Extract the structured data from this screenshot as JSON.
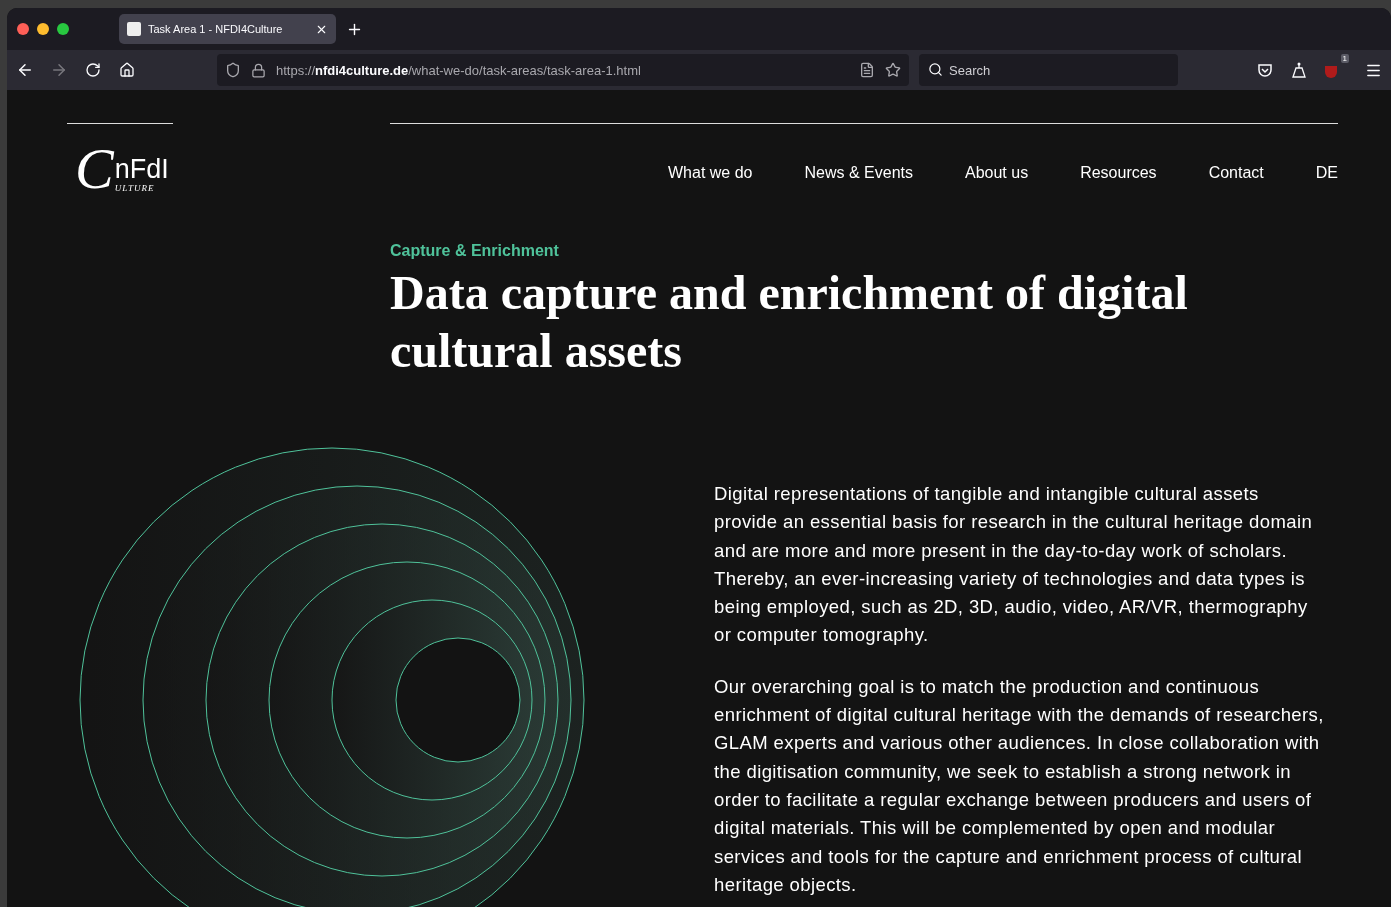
{
  "browser": {
    "tab": {
      "title": "Task Area 1 - NFDI4Culture",
      "selected": true
    },
    "url": {
      "scheme": "https://",
      "host": "nfdi4culture.de",
      "path": "/what-we-do/task-areas/task-area-1.html"
    },
    "search": {
      "placeholder": "Search"
    },
    "extension_badge": "1"
  },
  "logo": {
    "initial": "C",
    "letters": "nFdI",
    "subline": "ULTURE"
  },
  "nav": [
    {
      "label": "What we do"
    },
    {
      "label": "News & Events"
    },
    {
      "label": "About us"
    },
    {
      "label": "Resources"
    },
    {
      "label": "Contact"
    },
    {
      "label": "DE"
    }
  ],
  "eyebrow": "Capture & Enrichment",
  "title": "Data capture and enrichment of digital cultural assets",
  "paragraphs": [
    "Digital representations of tangible and intangible cultural assets provide an essential basis for research in the cultural heritage domain and are more and more present in the day-to-day work of scholars. Thereby, an ever-increasing variety of technologies and data types is being employed, such as 2D, 3D, audio, video, AR/VR, thermography or computer tomography.",
    "Our overarching goal is to match the production and continuous enrichment of digital cultural heritage with the demands of researchers, GLAM experts and various other audiences. In close collaboration with the digitisation community, we seek to establish a strong network in order to facilitate a regular exchange between producers and users of digital materials. This will be complemented by open and modular services and tools for the capture and enrichment process of cultural heritage objects."
  ]
}
